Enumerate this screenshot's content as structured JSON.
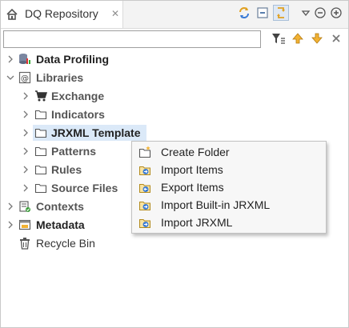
{
  "view": {
    "tab_label": "DQ Repository",
    "tab_close": "✕"
  },
  "filter": {
    "value": "",
    "placeholder": ""
  },
  "tree": {
    "data_profiling": "Data Profiling",
    "libraries": "Libraries",
    "exchange": "Exchange",
    "indicators": "Indicators",
    "jrxml_template": "JRXML Template",
    "patterns": "Patterns",
    "rules": "Rules",
    "source_files": "Source Files",
    "contexts": "Contexts",
    "metadata": "Metadata",
    "recycle_bin": "Recycle Bin"
  },
  "context_menu": {
    "items": [
      {
        "label": "Create Folder",
        "icon": "folder-add-icon"
      },
      {
        "label": "Import Items",
        "icon": "import-items-icon"
      },
      {
        "label": "Export Items",
        "icon": "export-items-icon"
      },
      {
        "label": "Import Built-in JRXML",
        "icon": "import-builtin-jrxml-icon"
      },
      {
        "label": "Import JRXML",
        "icon": "import-jrxml-icon"
      }
    ]
  },
  "colors": {
    "selection": "#dbe9f8",
    "menu_bg": "#f7f7f7",
    "accent_yellow": "#f2b233"
  }
}
